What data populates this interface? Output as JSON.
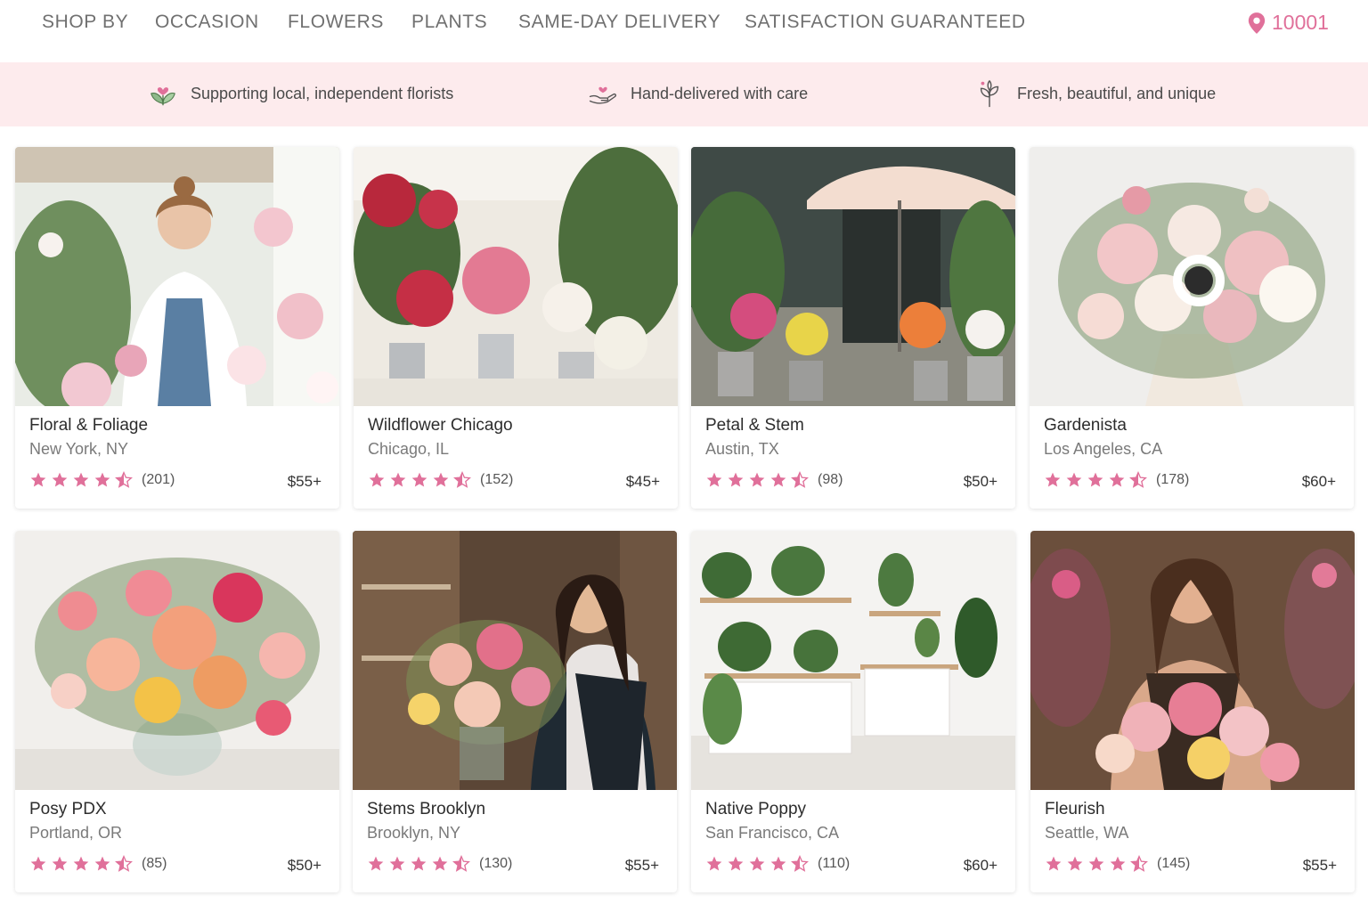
{
  "nav": {
    "items": [
      "SHOP BY",
      "OCCASION",
      "FLOWERS",
      "PLANTS",
      "SAME-DAY DELIVERY",
      "SATISFACTION GUARANTEED"
    ],
    "zip": "10001"
  },
  "promo": {
    "items": [
      {
        "icon": "heart-leaf-icon",
        "text": "Supporting local, independent florists"
      },
      {
        "icon": "hand-heart-icon",
        "text": "Hand-delivered with care"
      },
      {
        "icon": "sprout-icon",
        "text": "Fresh, beautiful, and unique"
      }
    ]
  },
  "colors": {
    "accent": "#e0709a",
    "promo_bg": "#fdebed",
    "star": "#e0709a"
  },
  "florists": [
    {
      "name": "Floral & Foliage",
      "location": "New York, NY",
      "rating": 4.5,
      "reviews": "(201)",
      "price": "$55+"
    },
    {
      "name": "Wildflower Chicago",
      "location": "Chicago, IL",
      "rating": 4.5,
      "reviews": "(152)",
      "price": "$45+"
    },
    {
      "name": "Petal & Stem",
      "location": "Austin, TX",
      "rating": 4.5,
      "reviews": "(98)",
      "price": "$50+"
    },
    {
      "name": "Gardenista",
      "location": "Los Angeles, CA",
      "rating": 4.5,
      "reviews": "(178)",
      "price": "$60+"
    },
    {
      "name": "Posy PDX",
      "location": "Portland, OR",
      "rating": 4.5,
      "reviews": "(85)",
      "price": "$50+"
    },
    {
      "name": "Stems Brooklyn",
      "location": "Brooklyn, NY",
      "rating": 4.5,
      "reviews": "(130)",
      "price": "$55+"
    },
    {
      "name": "Native Poppy",
      "location": "San Francisco, CA",
      "rating": 4.5,
      "reviews": "(110)",
      "price": "$60+"
    },
    {
      "name": "Fleurish",
      "location": "Seattle, WA",
      "rating": 4.5,
      "reviews": "(145)",
      "price": "$55+"
    }
  ]
}
